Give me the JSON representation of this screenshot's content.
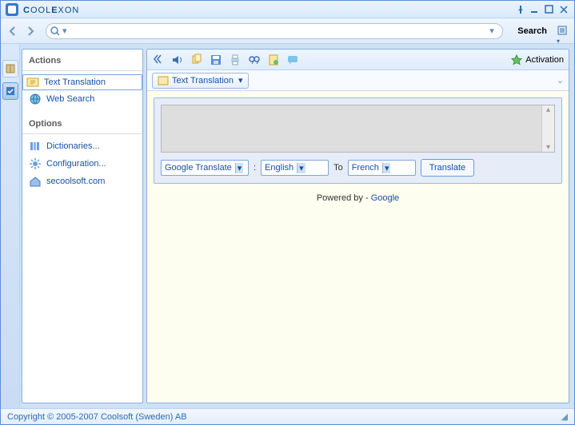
{
  "titlebar": {
    "title_part1": "C",
    "title_part2": "OOL",
    "title_part3": "E",
    "title_part4": "XON"
  },
  "nav": {
    "search_placeholder": "",
    "search_label": "Search"
  },
  "sidebar": {
    "heading_actions": "Actions",
    "heading_options": "Options",
    "items": {
      "text_translation": "Text Translation",
      "web_search": "Web Search",
      "dictionaries": "Dictionaries...",
      "configuration": "Configuration...",
      "site": "secoolsoft.com"
    }
  },
  "toolbar": {
    "activation": "Activation"
  },
  "tabs": {
    "text_translation": "Text Translation"
  },
  "translate": {
    "engine": "Google Translate",
    "from": "English",
    "to_label": "To",
    "to": "French",
    "button": "Translate",
    "colon": ":"
  },
  "powered": {
    "prefix": "Powered by - ",
    "link": "Google"
  },
  "footer": {
    "copyright": "Copyright © 2005-2007 Coolsoft (Sweden) AB"
  }
}
